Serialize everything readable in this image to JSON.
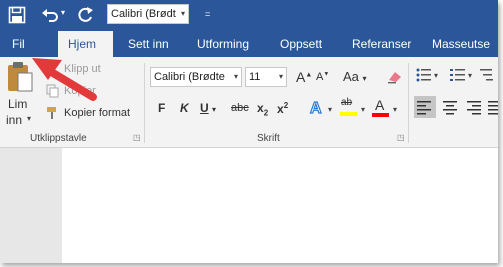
{
  "qat": {
    "font_name": "Calibri (Brødt",
    "icons": [
      "save-icon",
      "undo-icon",
      "redo-icon",
      "customize-icon"
    ]
  },
  "tabs": [
    "Fil",
    "Hjem",
    "Sett inn",
    "Utforming",
    "Oppsett",
    "Referanser",
    "Masseutse"
  ],
  "clipboard": {
    "paste_label_line1": "Lim",
    "paste_label_line2": "inn",
    "cut_label": "Klipp ut",
    "copy_label": "Kopier",
    "format_painter_label": "Kopier format",
    "group_label": "Utklippstavle"
  },
  "font": {
    "name": "Calibri (Brødte",
    "size": "11",
    "bold": "F",
    "italic": "K",
    "underline": "U",
    "strikethrough": "abc",
    "subscript": "x",
    "subscript_digit": "2",
    "superscript": "x",
    "superscript_digit": "2",
    "change_case": "Aa",
    "group_label": "Skrift",
    "highlight_letter": "ab",
    "font_color_letter": "A",
    "grow_label": "A",
    "shrink_label": "A"
  },
  "colors": {
    "accent": "#2b579a",
    "highlight_yellow": "#ffff00",
    "font_red": "#ff0000",
    "arrow_red": "#e2393b"
  }
}
